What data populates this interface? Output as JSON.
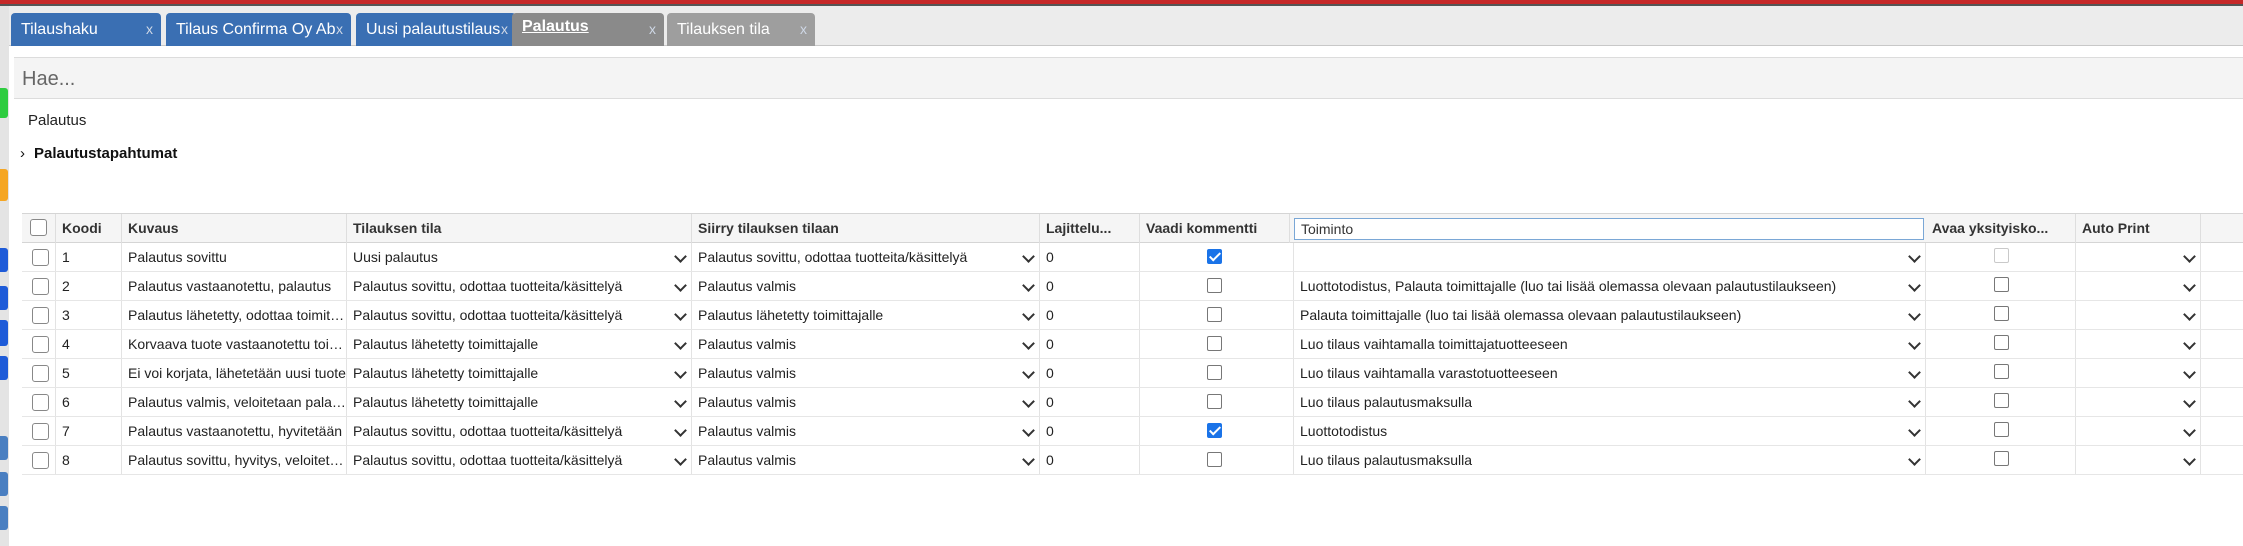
{
  "tabs": [
    {
      "label": "Tilaushaku",
      "close": "x"
    },
    {
      "label": "Tilaus Confirma Oy Ab",
      "close": "x"
    },
    {
      "label": "Uusi palautustilaus",
      "close": "x"
    },
    {
      "label": "Palautus",
      "close": "x"
    },
    {
      "label": "Tilauksen tila",
      "close": "x"
    }
  ],
  "search": {
    "placeholder": "Hae...",
    "value": ""
  },
  "section": {
    "title": "Palautus",
    "events_label": "Palautustapahtumat"
  },
  "columns": [
    "Koodi",
    "Kuvaus",
    "Tilauksen tila",
    "Siirry tilauksen tilaan",
    "Lajittelu...",
    "Vaadi kommentti",
    "Toiminto",
    "Avaa yksityisko...",
    "Auto Print"
  ],
  "rows": [
    {
      "koodi": "1",
      "kuvaus": "Palautus sovittu",
      "tila": "Uusi palautus",
      "siirry": "Palautus sovittu, odottaa tuotteita/käsittelyä",
      "lajittelu": "0",
      "vaadi": true,
      "toiminto": "",
      "avaa": "disabled"
    },
    {
      "koodi": "2",
      "kuvaus": "Palautus vastaanotettu, palautus",
      "tila": "Palautus sovittu, odottaa tuotteita/käsittelyä",
      "siirry": "Palautus valmis",
      "lajittelu": "0",
      "vaadi": false,
      "toiminto": "Luottotodistus, Palauta toimittajalle (luo tai lisää olemassa olevaan palautustilaukseen)",
      "avaa": "unchecked"
    },
    {
      "koodi": "3",
      "kuvaus": "Palautus lähetetty, odottaa toimittajan",
      "tila": "Palautus sovittu, odottaa tuotteita/käsittelyä",
      "siirry": "Palautus lähetetty toimittajalle",
      "lajittelu": "0",
      "vaadi": false,
      "toiminto": "Palauta toimittajalle (luo tai lisää olemassa olevaan palautustilaukseen)",
      "avaa": "unchecked"
    },
    {
      "koodi": "4",
      "kuvaus": "Korvaava tuote vastaanotettu toimittajalta",
      "tila": "Palautus lähetetty toimittajalle",
      "siirry": "Palautus valmis",
      "lajittelu": "0",
      "vaadi": false,
      "toiminto": "Luo tilaus vaihtamalla toimittajatuotteeseen",
      "avaa": "unchecked"
    },
    {
      "koodi": "5",
      "kuvaus": "Ei voi korjata, lähetetään uusi tuote",
      "tila": "Palautus lähetetty toimittajalle",
      "siirry": "Palautus valmis",
      "lajittelu": "0",
      "vaadi": false,
      "toiminto": "Luo tilaus vaihtamalla varastotuotteeseen",
      "avaa": "unchecked"
    },
    {
      "koodi": "6",
      "kuvaus": "Palautus valmis, veloitetaan palautus",
      "tila": "Palautus lähetetty toimittajalle",
      "siirry": "Palautus valmis",
      "lajittelu": "0",
      "vaadi": false,
      "toiminto": "Luo tilaus palautusmaksulla",
      "avaa": "unchecked"
    },
    {
      "koodi": "7",
      "kuvaus": "Palautus vastaanotettu, hyvitetään",
      "tila": "Palautus sovittu, odottaa tuotteita/käsittelyä",
      "siirry": "Palautus valmis",
      "lajittelu": "0",
      "vaadi": true,
      "toiminto": "Luottotodistus",
      "avaa": "unchecked"
    },
    {
      "koodi": "8",
      "kuvaus": "Palautus sovittu, hyvitys, veloitetaan",
      "tila": "Palautus sovittu, odottaa tuotteita/käsittelyä",
      "siirry": "Palautus valmis",
      "lajittelu": "0",
      "vaadi": false,
      "toiminto": "Luo tilaus palautusmaksulla",
      "avaa": "unchecked"
    }
  ],
  "colors": {
    "tab_blue": "#3a6fb3",
    "tab_active": "#8a8a8a",
    "check_blue": "#1a73e8",
    "accent_red": "#c62828"
  }
}
